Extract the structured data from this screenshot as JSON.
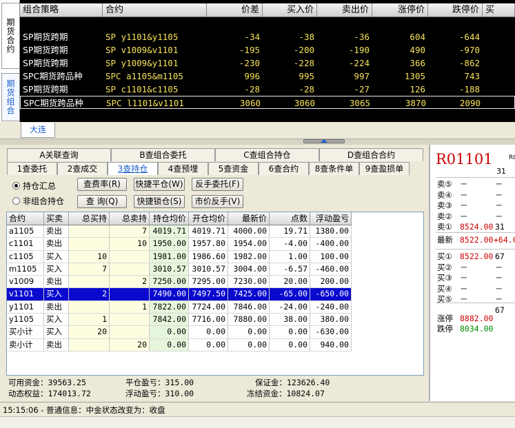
{
  "combo": {
    "side_tabs": [
      "期货合约",
      "期货组合"
    ],
    "headers": [
      "组合策略",
      "合约",
      "价差",
      "买入价",
      "卖出价",
      "涨停价",
      "跌停价",
      "买"
    ],
    "rows": [
      {
        "strategy": "SP期货跨期",
        "contract": "SP y1101&y1105",
        "spread": "-34",
        "bid": "-38",
        "ask": "-36",
        "limit_up": "604",
        "limit_down": "-644"
      },
      {
        "strategy": "SP期货跨期",
        "contract": "SP v1009&v1101",
        "spread": "-195",
        "bid": "-200",
        "ask": "-190",
        "limit_up": "490",
        "limit_down": "-970"
      },
      {
        "strategy": "SP期货跨期",
        "contract": "SP y1009&y1101",
        "spread": "-230",
        "bid": "-228",
        "ask": "-224",
        "limit_up": "366",
        "limit_down": "-862"
      },
      {
        "strategy": "SPC期货跨品种",
        "contract": "SPC a1105&m1105",
        "spread": "996",
        "bid": "995",
        "ask": "997",
        "limit_up": "1305",
        "limit_down": "743"
      },
      {
        "strategy": "SP期货跨期",
        "contract": "SP c1101&c1105",
        "spread": "-28",
        "bid": "-28",
        "ask": "-27",
        "limit_up": "126",
        "limit_down": "-188"
      },
      {
        "strategy": "SPC期货跨品种",
        "contract": "SPC l1101&v1101",
        "spread": "3060",
        "bid": "3060",
        "ask": "3065",
        "limit_up": "3870",
        "limit_down": "2090"
      }
    ],
    "exchange_tab": "大连"
  },
  "tabs_a": [
    "A关联查询",
    "B查组合委托",
    "C查组合持仓",
    "D查组合合约"
  ],
  "tabs_b": [
    "1查委托",
    "2查成交",
    "3查持仓",
    "4查预埋",
    "5查资金",
    "6查合约",
    "8查条件单",
    "9查盈损单"
  ],
  "options": {
    "summary": "持仓汇总",
    "non_combo": "非组合持仓"
  },
  "buttons": {
    "fee_rate": "查费率(R)",
    "quick_close": "快捷平仓(W)",
    "reverse_order": "反手委托(F)",
    "query": "查 询(Q)",
    "quick_lock": "快捷锁仓(S)",
    "market_reverse": "市价反手(V)"
  },
  "positions": {
    "headers": [
      "合约",
      "买卖",
      "总买持",
      "总卖持",
      "持仓均价",
      "开仓均价",
      "最新价",
      "点数",
      "浮动盈亏"
    ],
    "rows": [
      {
        "contract": "a1105",
        "side": "卖出",
        "buy": "",
        "sell": "7",
        "hold_avg": "4019.71",
        "open_avg": "4019.71",
        "last": "4000.00",
        "points": "19.71",
        "pnl": "1380.00"
      },
      {
        "contract": "c1101",
        "side": "卖出",
        "buy": "",
        "sell": "10",
        "hold_avg": "1950.00",
        "open_avg": "1957.80",
        "last": "1954.00",
        "points": "-4.00",
        "pnl": "-400.00"
      },
      {
        "contract": "c1105",
        "side": "买入",
        "buy": "10",
        "sell": "",
        "hold_avg": "1981.00",
        "open_avg": "1986.60",
        "last": "1982.00",
        "points": "1.00",
        "pnl": "100.00"
      },
      {
        "contract": "m1105",
        "side": "买入",
        "buy": "7",
        "sell": "",
        "hold_avg": "3010.57",
        "open_avg": "3010.57",
        "last": "3004.00",
        "points": "-6.57",
        "pnl": "-460.00"
      },
      {
        "contract": "v1009",
        "side": "卖出",
        "buy": "",
        "sell": "2",
        "hold_avg": "7250.00",
        "open_avg": "7295.00",
        "last": "7230.00",
        "points": "20.00",
        "pnl": "200.00"
      },
      {
        "contract": "v1101",
        "side": "买入",
        "buy": "2",
        "sell": "",
        "hold_avg": "7490.00",
        "open_avg": "7497.50",
        "last": "7425.00",
        "points": "-65.00",
        "pnl": "-650.00"
      },
      {
        "contract": "y1101",
        "side": "卖出",
        "buy": "",
        "sell": "1",
        "hold_avg": "7822.00",
        "open_avg": "7724.00",
        "last": "7846.00",
        "points": "-24.00",
        "pnl": "-240.00"
      },
      {
        "contract": "y1105",
        "side": "买入",
        "buy": "1",
        "sell": "",
        "hold_avg": "7842.00",
        "open_avg": "7716.00",
        "last": "7880.00",
        "points": "38.00",
        "pnl": "380.00"
      },
      {
        "contract": "买小计",
        "side": "买入",
        "buy": "20",
        "sell": "",
        "hold_avg": "0.00",
        "open_avg": "0.00",
        "last": "0.00",
        "points": "0.00",
        "pnl": "-630.00"
      },
      {
        "contract": "卖小计",
        "side": "卖出",
        "buy": "",
        "sell": "20",
        "hold_avg": "0.00",
        "open_avg": "0.00",
        "last": "0.00",
        "points": "0.00",
        "pnl": "940.00"
      }
    ],
    "selected_index": 5
  },
  "summary": {
    "available_label": "可用资金：",
    "available": "39563.25",
    "equity_label": "动态权益：",
    "equity": "174013.72",
    "close_pnl_label": "平仓盈亏：",
    "close_pnl": "315.00",
    "float_pnl_label": "浮动盈亏：",
    "float_pnl": "310.00",
    "margin_label": "保证金：",
    "margin": "123626.40",
    "frozen_label": "冻结资金：",
    "frozen": "10824.07"
  },
  "quote": {
    "symbol": "R01101",
    "symbol_suffix": "R0",
    "volume": "31",
    "asks": [
      {
        "label": "卖⑤",
        "price": "－",
        "qty": "－"
      },
      {
        "label": "卖④",
        "price": "－",
        "qty": "－"
      },
      {
        "label": "卖③",
        "price": "－",
        "qty": "－"
      },
      {
        "label": "卖②",
        "price": "－",
        "qty": "－"
      },
      {
        "label": "卖①",
        "price": "8524.00",
        "qty": "31"
      }
    ],
    "last_label": "最新",
    "last_price": "8522.00",
    "last_change": "+64.0",
    "bids": [
      {
        "label": "买①",
        "price": "8522.00",
        "qty": "67"
      },
      {
        "label": "买②",
        "price": "－",
        "qty": "－"
      },
      {
        "label": "买③",
        "price": "－",
        "qty": "－"
      },
      {
        "label": "买④",
        "price": "－",
        "qty": "－"
      },
      {
        "label": "买⑤",
        "price": "－",
        "qty": "－"
      }
    ],
    "extra_qty": "67",
    "limit_up_label": "涨停",
    "limit_up": "8882.00",
    "limit_down_label": "跌停",
    "limit_down": "8034.00"
  },
  "status": {
    "message": "15:15:06 - 普通信息：中金状态改变为：收盘"
  }
}
